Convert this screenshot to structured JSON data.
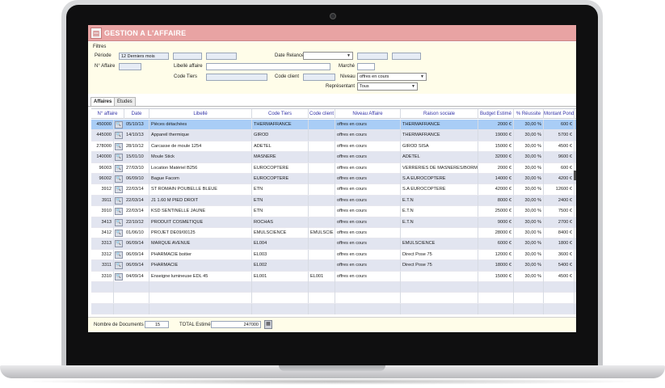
{
  "app": {
    "title": "GESTION A L'AFFAIRE",
    "icon": "document-icon"
  },
  "filters": {
    "section_label": "Filtres",
    "periode_label": "Période",
    "periode_value": "12 Derniers mois",
    "num_affaire_label": "N° Affaire",
    "date_relance_label": "Date Relance",
    "libelle_affaire_label": "Libellé affaire",
    "marche_label": "Marché",
    "code_tiers_label": "Code Tiers",
    "code_client_label": "Code client",
    "niveau_label": "Niveau",
    "niveau_value": "offres en cours",
    "representant_label": "Représentant",
    "representant_value": "Tous"
  },
  "tabs": [
    {
      "label": "Affaires",
      "active": true
    },
    {
      "label": "Etudes",
      "active": false
    }
  ],
  "table": {
    "columns": [
      "N° affaire",
      "Date",
      "Libellé",
      "Code Tiers",
      "Code client",
      "Niveau Affaire",
      "Raison sociale",
      "Budget Estimé",
      "% Réussite",
      "Montant Pondé"
    ],
    "rows": [
      {
        "num": "450000",
        "date": "05/10/13",
        "libelle": "Pièces détachées",
        "tiers": "THERMAFRANCE",
        "client": "",
        "niveau": "offres en cours",
        "raison": "THERMAFRANCE",
        "budget": "2000 €",
        "reussite": "30,00 %",
        "montant": "600 €"
      },
      {
        "num": "445000",
        "date": "14/10/13",
        "libelle": "Appareil thermique",
        "tiers": "GIROD",
        "client": "",
        "niveau": "offres en cours",
        "raison": "THERMAFRANCE",
        "budget": "19000 €",
        "reussite": "30,00 %",
        "montant": "5700 €"
      },
      {
        "num": "278000",
        "date": "28/10/12",
        "libelle": "Carcasse de moule 1254",
        "tiers": "ADETEL",
        "client": "",
        "niveau": "offres en cours",
        "raison": "GIROD SISA",
        "budget": "15000 €",
        "reussite": "30,00 %",
        "montant": "4500 €"
      },
      {
        "num": "140000",
        "date": "15/01/10",
        "libelle": "Moule Stick",
        "tiers": "MASNERE",
        "client": "",
        "niveau": "offres en cours",
        "raison": "ADETEL",
        "budget": "32000 €",
        "reussite": "30,00 %",
        "montant": "9600 €"
      },
      {
        "num": "96003",
        "date": "27/03/10",
        "libelle": "Location Matériel B256",
        "tiers": "EUROCOPTERE",
        "client": "",
        "niveau": "offres en cours",
        "raison": "VERRERIES DE MASNERES/BORM-",
        "budget": "2000 €",
        "reussite": "30,00 %",
        "montant": "600 €"
      },
      {
        "num": "96002",
        "date": "06/09/10",
        "libelle": "Bague Facom",
        "tiers": "EUROCOPTERE",
        "client": "",
        "niveau": "offres en cours",
        "raison": "S.A EUROCOPTERE",
        "budget": "14000 €",
        "reussite": "30,00 %",
        "montant": "4200 €"
      },
      {
        "num": "3912",
        "date": "22/03/14",
        "libelle": "ST ROMAIN POUBELLE BLEUE",
        "tiers": "ETN",
        "client": "",
        "niveau": "offres en cours",
        "raison": "S.A EUROCOPTERE",
        "budget": "42000 €",
        "reussite": "30,00 %",
        "montant": "12600 €"
      },
      {
        "num": "3911",
        "date": "22/03/14",
        "libelle": "J1 1.60 M PIED DROIT",
        "tiers": "ETN",
        "client": "",
        "niveau": "offres en cours",
        "raison": "E.T.N",
        "budget": "8000 €",
        "reussite": "30,00 %",
        "montant": "2400 €"
      },
      {
        "num": "3910",
        "date": "22/03/14",
        "libelle": "KSD SENTINELLE JAUNE",
        "tiers": "ETN",
        "client": "",
        "niveau": "offres en cours",
        "raison": "E.T.N",
        "budget": "25000 €",
        "reussite": "30,00 %",
        "montant": "7500 €"
      },
      {
        "num": "3413",
        "date": "22/10/12",
        "libelle": "PRODUIT COSMETIQUE",
        "tiers": "ROCHAS",
        "client": "",
        "niveau": "offres en cours",
        "raison": "E.T.N",
        "budget": "9000 €",
        "reussite": "30,00 %",
        "montant": "2700 €"
      },
      {
        "num": "3412",
        "date": "01/06/10",
        "libelle": "PROJET DE09/00125",
        "tiers": "EMULSCIENCE",
        "client": "EMULSCIE",
        "niveau": "offres en cours",
        "raison": "",
        "budget": "28000 €",
        "reussite": "30,00 %",
        "montant": "8400 €"
      },
      {
        "num": "3313",
        "date": "06/09/14",
        "libelle": "MARQUE AVENUE",
        "tiers": "EL004",
        "client": "",
        "niveau": "offres en cours",
        "raison": "EMULSCIENCE",
        "budget": "6000 €",
        "reussite": "30,00 %",
        "montant": "1800 €"
      },
      {
        "num": "3312",
        "date": "06/09/14",
        "libelle": "PHARMACIE boitier",
        "tiers": "EL003",
        "client": "",
        "niveau": "offres en cours",
        "raison": "Direct Pose 75",
        "budget": "12000 €",
        "reussite": "30,00 %",
        "montant": "3600 €"
      },
      {
        "num": "3311",
        "date": "06/09/14",
        "libelle": "PHARMACIE",
        "tiers": "EL002",
        "client": "",
        "niveau": "offres en cours",
        "raison": "Direct Pose 75",
        "budget": "18000 €",
        "reussite": "30,00 %",
        "montant": "5400 €"
      },
      {
        "num": "3310",
        "date": "04/09/14",
        "libelle": "Enseigne lumineuse EDL 45",
        "tiers": "EL001",
        "client": "EL001",
        "niveau": "offres en cours",
        "raison": "",
        "budget": "15000 €",
        "reussite": "30,00 %",
        "montant": "4500 €"
      }
    ]
  },
  "footer": {
    "nb_documents_label": "Nombre de Documents",
    "nb_documents_value": "15",
    "total_label": "TOTAL Estimé",
    "total_value": "247000"
  },
  "colors": {
    "titlebar": "#e8a3a3",
    "filter_background": "#fffde9",
    "selected_row": "#a9cdf6",
    "alternate_row": "#e2e5f0",
    "header_text": "#3535a8"
  }
}
